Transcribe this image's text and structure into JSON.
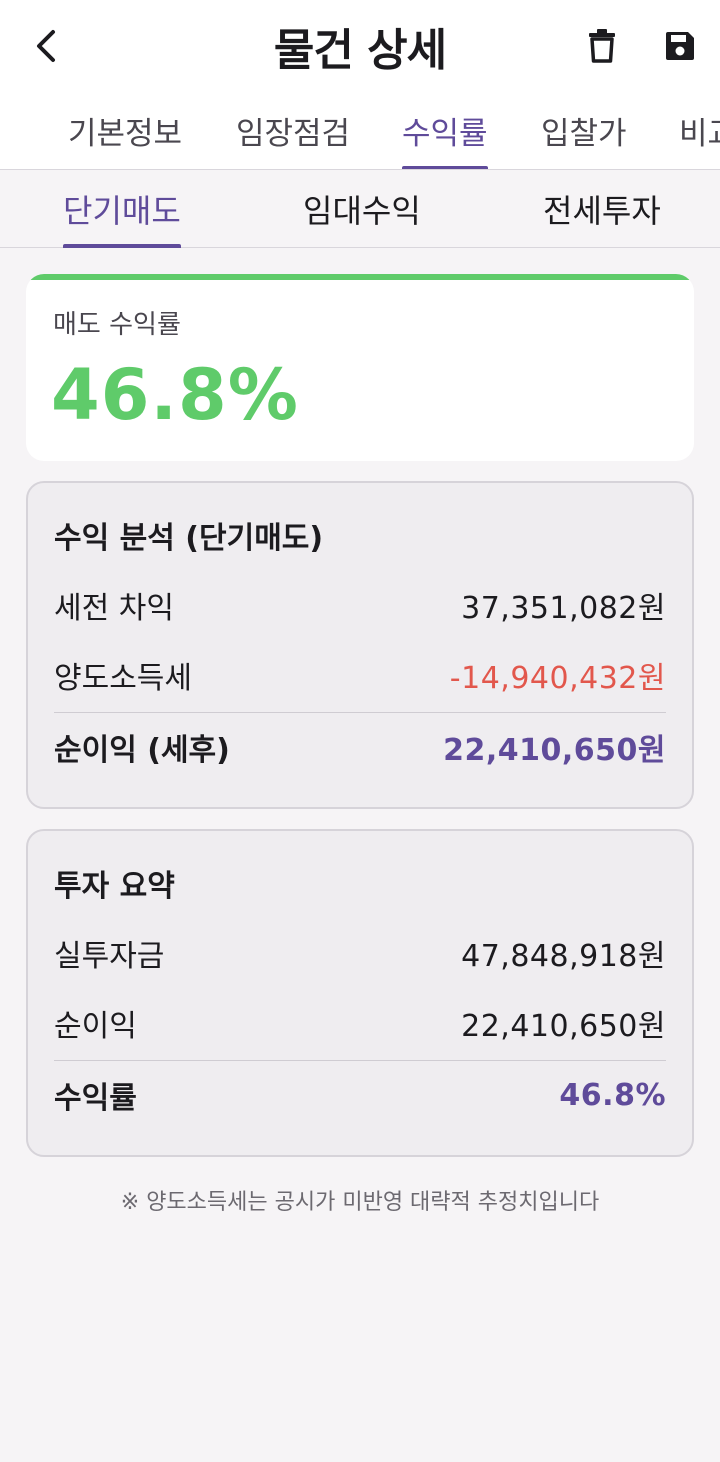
{
  "header": {
    "title": "물건 상세",
    "back_icon": "chevron-left-icon",
    "delete_icon": "trash-icon",
    "save_icon": "save-icon"
  },
  "primary_tabs": [
    "기본정보",
    "임장점검",
    "수익률",
    "입찰가",
    "비교"
  ],
  "primary_tab_active": "수익률",
  "sub_tabs": [
    "단기매도",
    "임대수익",
    "전세투자"
  ],
  "sub_tab_active": "단기매도",
  "yield_card": {
    "label": "매도 수익률",
    "value": "46.8%",
    "accent_color": "#5fcb6a"
  },
  "analysis": {
    "title": "수익 분석 (단기매도)",
    "rows": [
      {
        "label": "세전 차익",
        "value": "37,351,082원"
      },
      {
        "label": "양도소득세",
        "value": "-14,940,432원"
      }
    ],
    "total": {
      "label": "순이익 (세후)",
      "value": "22,410,650원"
    }
  },
  "summary": {
    "title": "투자 요약",
    "rows": [
      {
        "label": "실투자금",
        "value": "47,848,918원"
      },
      {
        "label": "순이익",
        "value": "22,410,650원"
      }
    ],
    "total": {
      "label": "수익률",
      "value": "46.8%"
    }
  },
  "footnote": "※ 양도소득세는 공시가 미반영 대략적 추정치입니다",
  "colors": {
    "primary": "#5f4b9a",
    "positive": "#5fcb6a",
    "negative": "#e2574c"
  }
}
